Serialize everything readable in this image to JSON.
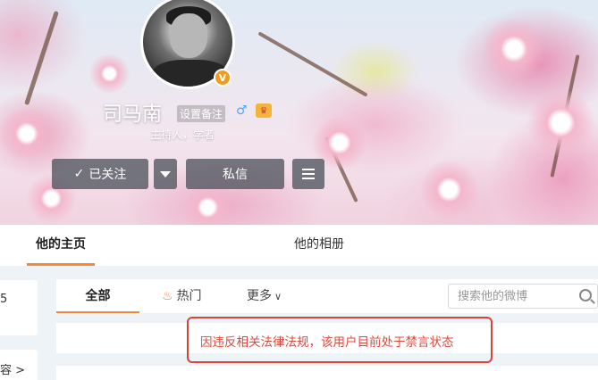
{
  "profile": {
    "name": "司马南",
    "remark_label": "设置备注",
    "role": "主持人，学者",
    "verified_badge": "V",
    "gender_icon": "male-icon",
    "member_icon": "vip-crown-icon"
  },
  "actions": {
    "follow_label": "已关注",
    "message_label": "私信"
  },
  "tabs": [
    {
      "label": "他的主页",
      "active": true
    },
    {
      "label": "他的相册",
      "active": false
    }
  ],
  "sidebar": {
    "fragment_1": "5",
    "fragment_2": "容 >"
  },
  "feed_filter": {
    "all_label": "全部",
    "hot_label": "热门",
    "more_label": "更多",
    "search_placeholder": "搜索他的微博"
  },
  "notice": {
    "text": "因违反相关法律法规，该用户目前处于禁言状态"
  },
  "colors": {
    "accent": "#f08b3a",
    "notice_red": "#e0483c",
    "button_bg": "#50555f"
  }
}
